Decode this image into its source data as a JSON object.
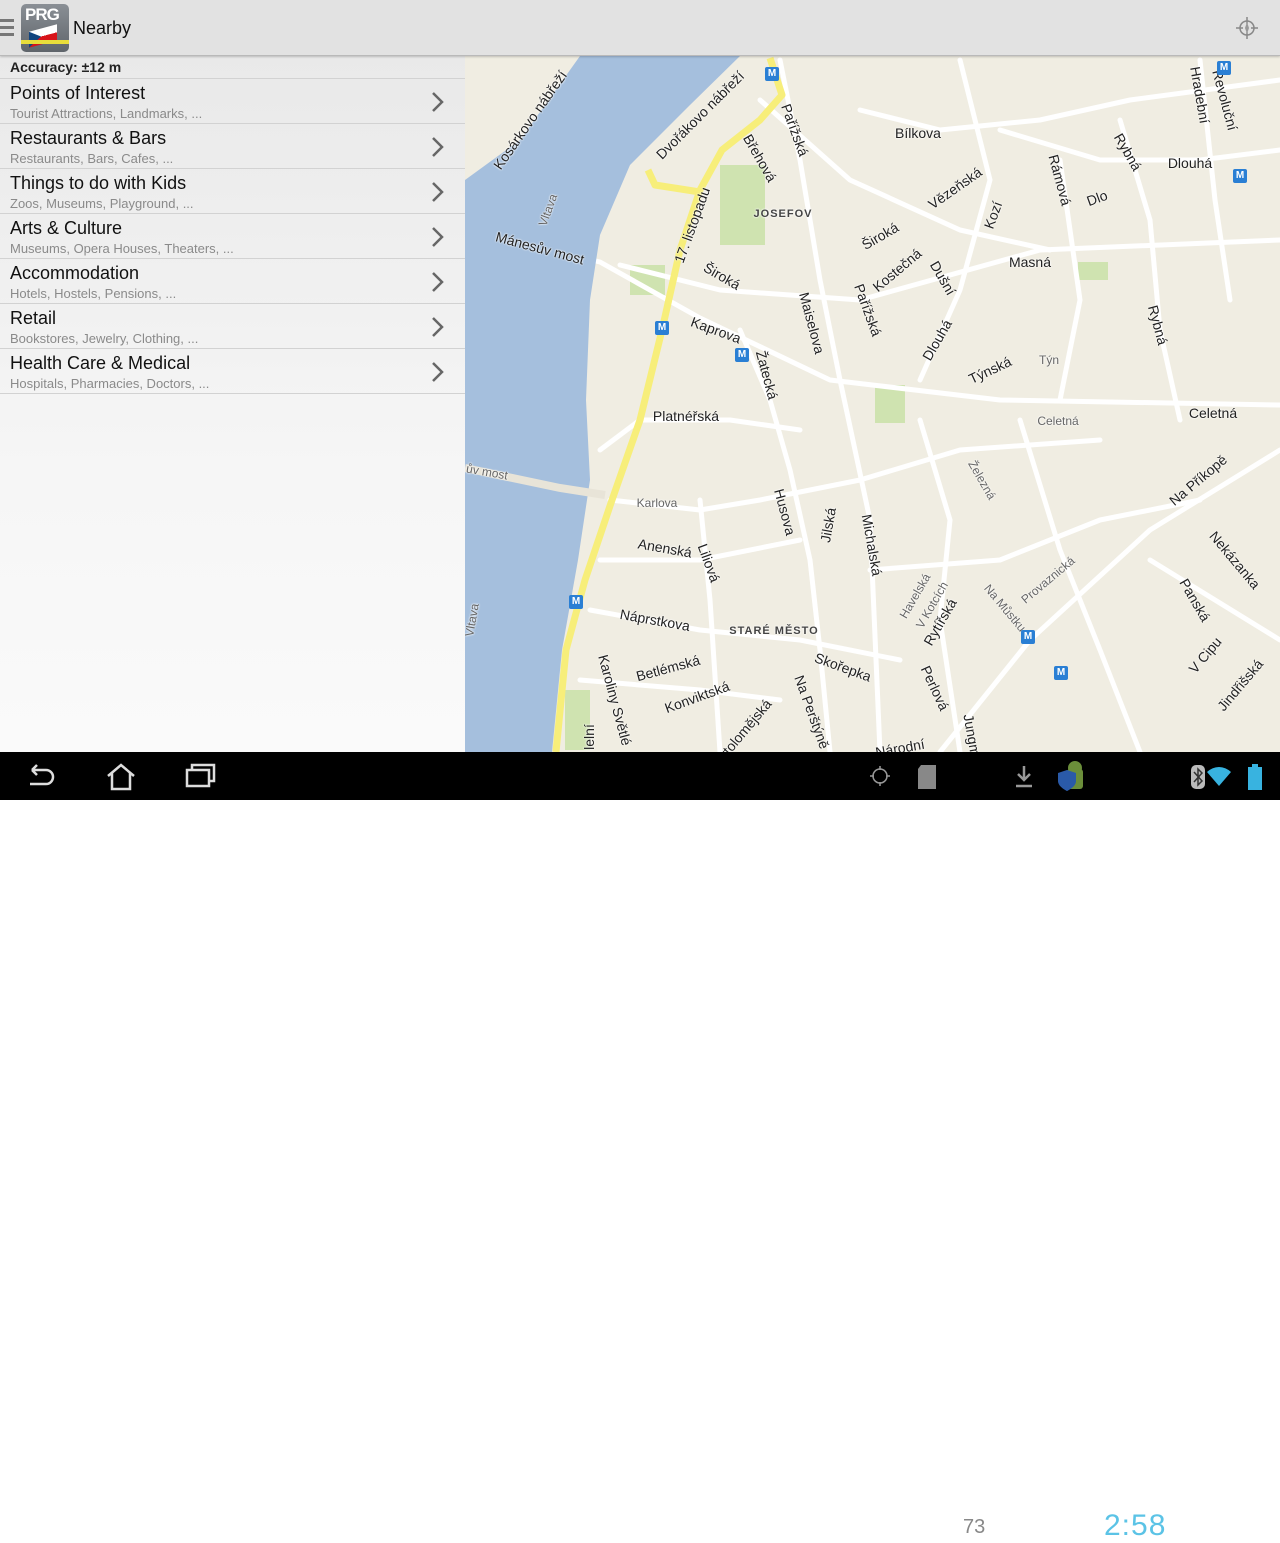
{
  "header": {
    "title": "Nearby",
    "logo_text": "PRG"
  },
  "panel": {
    "accuracy": "Accuracy: ±12 m",
    "items": [
      {
        "title": "Points of Interest",
        "subtitle": "Tourist Attractions, Landmarks, ..."
      },
      {
        "title": "Restaurants & Bars",
        "subtitle": "Restaurants, Bars, Cafes, ..."
      },
      {
        "title": "Things to do with Kids",
        "subtitle": "Zoos, Museums, Playground, ..."
      },
      {
        "title": "Arts & Culture",
        "subtitle": "Museums, Opera Houses, Theaters, ..."
      },
      {
        "title": "Accommodation",
        "subtitle": "Hotels, Hostels, Pensions, ..."
      },
      {
        "title": "Retail",
        "subtitle": "Bookstores, Jewelry, Clothing, ..."
      },
      {
        "title": "Health Care & Medical",
        "subtitle": "Hospitals, Pharmacies, Doctors, ..."
      }
    ]
  },
  "map": {
    "colors": {
      "water": "#a5bfdd",
      "land": "#f0ede2",
      "road": "#ffffff",
      "main_road": "#f7ee7a",
      "park": "#cfe3b0"
    },
    "labels": [
      "Kosárkovo nábřeží",
      "Dvořákovo nábřeží",
      "Pařížská",
      "Břehová",
      "Bílkova",
      "Hradební",
      "Revoluční",
      "Rámová",
      "Rybná",
      "Dlouhá",
      "Vězeňská",
      "JOSEFOV",
      "Vltava",
      "Mánesův most",
      "17. listopadu",
      "Široká",
      "Široká",
      "Kozí",
      "Dlo",
      "Kostečná",
      "Dušní",
      "Masná",
      "Maiselova",
      "Pařížská",
      "Kaprova",
      "Žatecká",
      "Dlouhá",
      "Týnská",
      "Týn",
      "Rybná",
      "Platnéřská",
      "Celetná",
      "Celetná",
      "Železná",
      "Na Příkopě",
      "ův most",
      "Karlova",
      "Husova",
      "Michalská",
      "Jilská",
      "Anenská",
      "Liliová",
      "Nekázanka",
      "Provaznická",
      "Havelská",
      "V Kotcích",
      "Na Můstku",
      "Rytířská",
      "Panská",
      "Vltava",
      "Náprstkova",
      "STARÉ MĚSTO",
      "V Cipu",
      "Jindřišská",
      "Karoliny Světlé",
      "Betlémská",
      "Skořepka",
      "Perlová",
      "Konviktská",
      "Na Perštýně",
      "Bartolomějská",
      "Národní",
      "Jungm",
      "lelní"
    ]
  },
  "statusbar": {
    "notification_count": "73",
    "clock": "2:58",
    "icons": [
      "back-icon",
      "home-icon",
      "recent-apps-icon",
      "gps-icon",
      "sd-card-icon",
      "download-icon",
      "security-android-icon",
      "bluetooth-icon",
      "wifi-icon",
      "battery-icon"
    ]
  }
}
